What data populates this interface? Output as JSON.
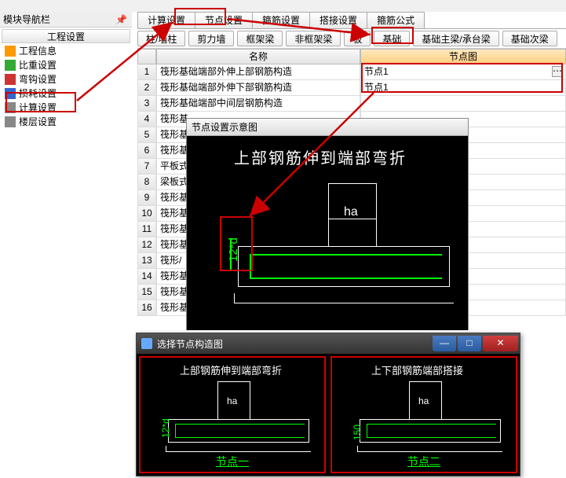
{
  "nav_title": "模块导航栏",
  "pin_glyph": "📌",
  "breadcrumb": "工程设置",
  "nav_items": [
    "工程信息",
    "比重设置",
    "弯钩设置",
    "损耗设置",
    "计算设置",
    "楼层设置"
  ],
  "tabs1": [
    "计算设置",
    "节点设置",
    "箍筋设置",
    "搭接设置",
    "箍筋公式"
  ],
  "tabs2": [
    "柱/墙柱",
    "剪力墙",
    "框架梁",
    "非框架梁",
    "板",
    "基础",
    "基础主梁/承台梁",
    "基础次梁"
  ],
  "grid_headers": {
    "name": "名称",
    "node": "节点图"
  },
  "rows": [
    {
      "n": "1",
      "name": "筏形基础端部外伸上部钢筋构造",
      "node": "节点1"
    },
    {
      "n": "2",
      "name": "筏形基础端部外伸下部钢筋构造",
      "node": "节点1"
    },
    {
      "n": "3",
      "name": "筏形基础端部中间层钢筋构造",
      "node": ""
    },
    {
      "n": "4",
      "name": "筏形基",
      "node": ""
    },
    {
      "n": "5",
      "name": "筏形基",
      "node": ""
    },
    {
      "n": "6",
      "name": "筏形基",
      "node": ""
    },
    {
      "n": "7",
      "name": "平板式",
      "node": ""
    },
    {
      "n": "8",
      "name": "梁板式",
      "node": ""
    },
    {
      "n": "9",
      "name": "筏形基",
      "node": ""
    },
    {
      "n": "10",
      "name": "筏形基",
      "node": ""
    },
    {
      "n": "11",
      "name": "筏形基",
      "node": ""
    },
    {
      "n": "12",
      "name": "筏形基",
      "node": ""
    },
    {
      "n": "13",
      "name": "筏形/",
      "node": ""
    },
    {
      "n": "14",
      "name": "筏形基",
      "node": ""
    },
    {
      "n": "15",
      "name": "筏形基",
      "node": ""
    },
    {
      "n": "16",
      "name": "筏形基",
      "node": ""
    }
  ],
  "dots": "⋯",
  "diagram_title": "节点设置示意图",
  "diagram_text": "上部钢筋伸到端部弯折",
  "ha": "ha",
  "d12": "12*d",
  "select_title": "选择节点构造图",
  "win_min": "—",
  "win_max": "□",
  "win_close": "✕",
  "opt1_title": "上部钢筋伸到端部弯折",
  "opt2_title": "上下部钢筋端部搭接",
  "d150": "150",
  "node_one": "节点一",
  "node_two": "节点二"
}
